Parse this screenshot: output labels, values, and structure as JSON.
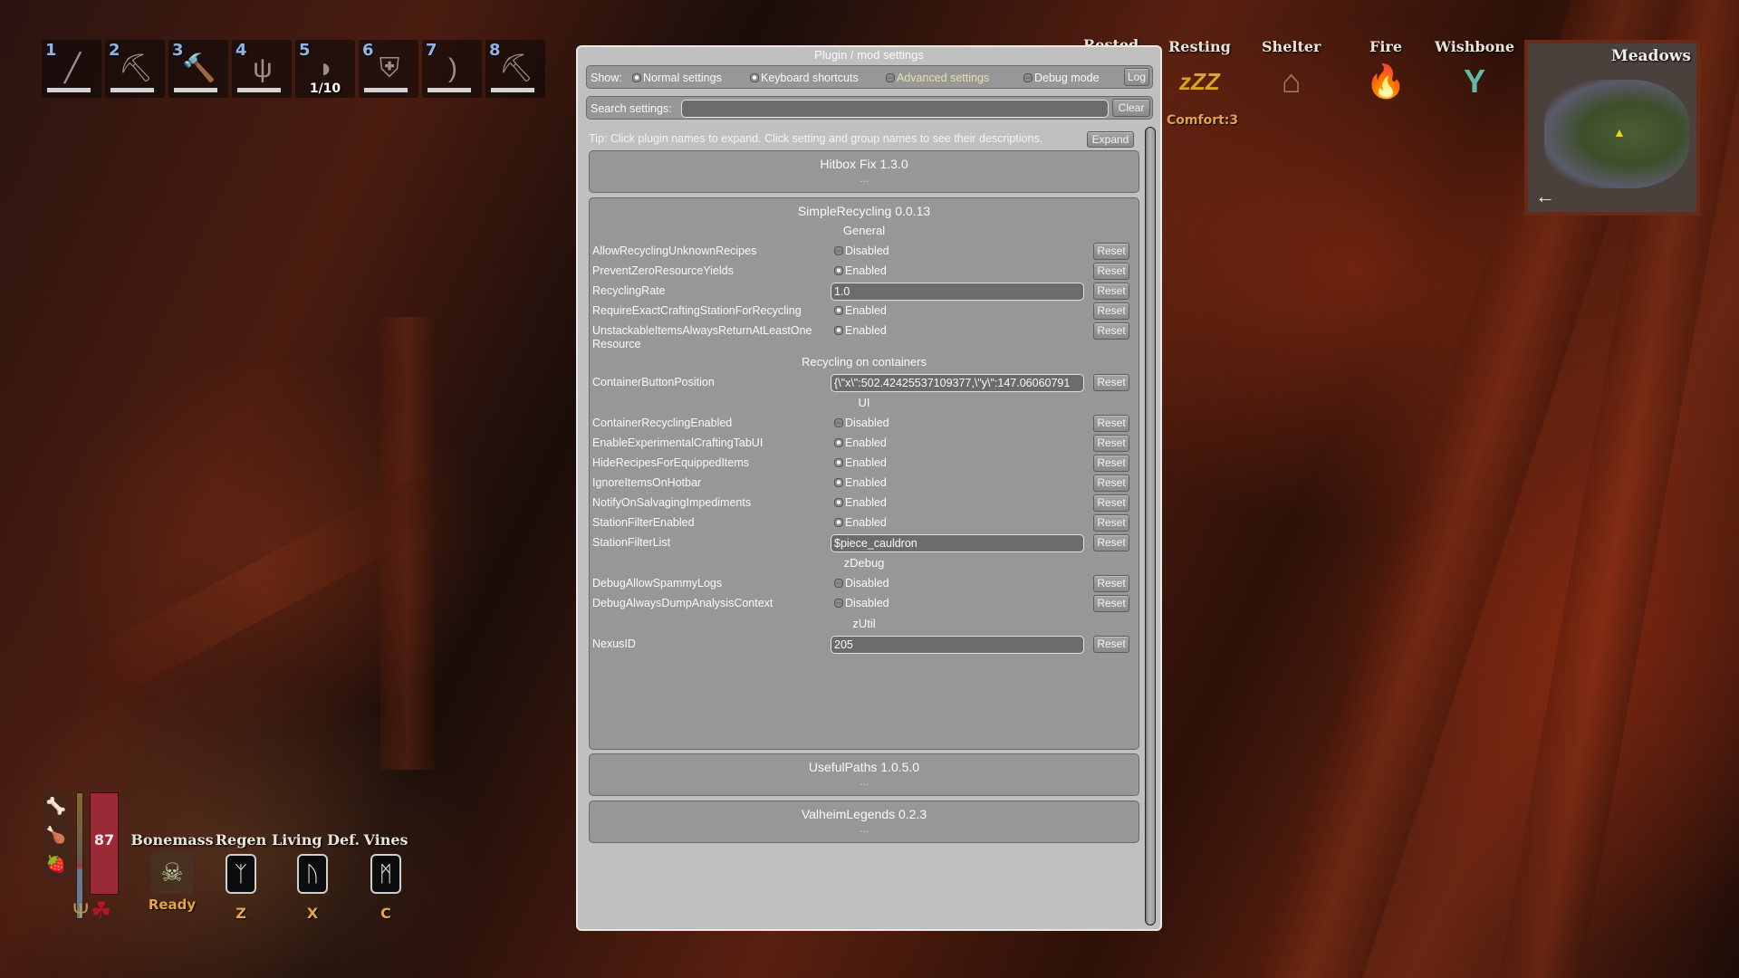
{
  "hotbar": [
    {
      "key": "1",
      "icon": "sword-icon",
      "glyph": "╱"
    },
    {
      "key": "2",
      "icon": "axe-icon",
      "glyph": "⛏"
    },
    {
      "key": "3",
      "icon": "hammer-icon",
      "glyph": "🔨"
    },
    {
      "key": "4",
      "icon": "cultivator-icon",
      "glyph": "ψ"
    },
    {
      "key": "5",
      "icon": "mead-horn-icon",
      "glyph": "◗",
      "count": "1/10"
    },
    {
      "key": "6",
      "icon": "shield-icon",
      "glyph": "⛨"
    },
    {
      "key": "7",
      "icon": "bow-icon",
      "glyph": ")"
    },
    {
      "key": "8",
      "icon": "pickaxe-icon",
      "glyph": "⛏"
    }
  ],
  "status_effects": [
    {
      "label": "Rested",
      "icon": ""
    },
    {
      "label": "Resting",
      "icon": "zzz-icon",
      "glyph": "zZZ"
    },
    {
      "label": "Shelter",
      "icon": "shelter-icon",
      "glyph": "⌂"
    },
    {
      "label": "Fire",
      "icon": "campfire-icon",
      "glyph": "🔥"
    },
    {
      "label": "Wishbone",
      "icon": "wishbone-icon",
      "glyph": "Y"
    }
  ],
  "comfort": "Comfort:3",
  "minimap": {
    "biome": "Meadows",
    "back_glyph": "←"
  },
  "hud": {
    "health": "87",
    "power": {
      "name": "Bonemass",
      "status": "Ready"
    },
    "abilities": [
      {
        "name": "Regen",
        "rune": "ᛉ",
        "key": "Z"
      },
      {
        "name": "Living Def.",
        "rune": "ᚢ",
        "key": "X"
      },
      {
        "name": "Vines",
        "rune": "ᛗ",
        "key": "C"
      }
    ]
  },
  "panel": {
    "title": "Plugin / mod settings",
    "show_label": "Show:",
    "show_options": [
      {
        "label": "Normal settings",
        "checked": true
      },
      {
        "label": "Keyboard shortcuts",
        "checked": true
      },
      {
        "label": "Advanced settings",
        "checked": false
      },
      {
        "label": "Debug mode",
        "checked": false
      }
    ],
    "log_button": "Log",
    "search_label": "Search settings:",
    "search_value": "",
    "clear_button": "Clear",
    "tip": "Tip: Click plugin names to expand. Click setting and group names to see their descriptions.",
    "expand_button": "Expand",
    "reset_label": "Reset",
    "collapsed_dots": "...",
    "plugins": [
      {
        "name": "Hitbox Fix 1.3.0"
      },
      {
        "name": "SimpleRecycling 0.0.13",
        "groups": [
          {
            "name": "General",
            "settings": [
              {
                "name": "AllowRecyclingUnknownRecipes",
                "type": "toggle",
                "value": "Disabled"
              },
              {
                "name": "PreventZeroResourceYields",
                "type": "toggle",
                "value": "Enabled"
              },
              {
                "name": "RecyclingRate",
                "type": "text",
                "value": "1.0"
              },
              {
                "name": "RequireExactCraftingStationForRecycling",
                "type": "toggle",
                "value": "Enabled"
              },
              {
                "name": "UnstackableItemsAlwaysReturnAtLeastOne Resource",
                "type": "toggle",
                "value": "Enabled"
              }
            ]
          },
          {
            "name": "Recycling on containers",
            "settings": [
              {
                "name": "ContainerButtonPosition",
                "type": "text",
                "value": "{\\\"x\\\":502.42425537109377,\\\"y\\\":147.06060791"
              }
            ]
          },
          {
            "name": "UI",
            "settings": [
              {
                "name": "ContainerRecyclingEnabled",
                "type": "toggle",
                "value": "Disabled"
              },
              {
                "name": "EnableExperimentalCraftingTabUI",
                "type": "toggle",
                "value": "Enabled"
              },
              {
                "name": "HideRecipesForEquippedItems",
                "type": "toggle",
                "value": "Enabled"
              },
              {
                "name": "IgnoreItemsOnHotbar",
                "type": "toggle",
                "value": "Enabled"
              },
              {
                "name": "NotifyOnSalvagingImpediments",
                "type": "toggle",
                "value": "Enabled"
              },
              {
                "name": "StationFilterEnabled",
                "type": "toggle",
                "value": "Enabled"
              },
              {
                "name": "StationFilterList",
                "type": "text",
                "value": "$piece_cauldron"
              }
            ]
          },
          {
            "name": "zDebug",
            "settings": [
              {
                "name": "DebugAllowSpammyLogs",
                "type": "toggle",
                "value": "Disabled"
              },
              {
                "name": "DebugAlwaysDumpAnalysisContext",
                "type": "toggle",
                "value": "Disabled"
              }
            ]
          },
          {
            "name": "zUtil",
            "settings": [
              {
                "name": "NexusID",
                "type": "text",
                "value": "205"
              }
            ]
          }
        ]
      },
      {
        "name": "UsefulPaths 1.0.5.0"
      },
      {
        "name": "ValheimLegends 0.2.3"
      }
    ]
  }
}
